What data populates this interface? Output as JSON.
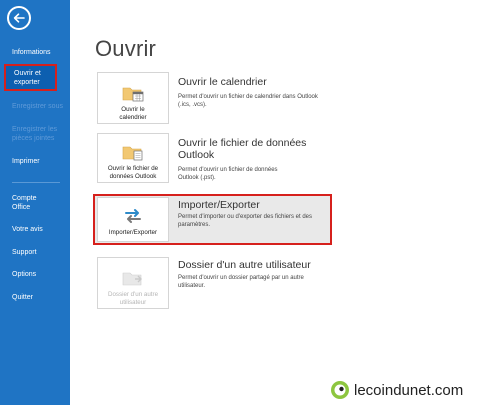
{
  "sidebar": {
    "items": [
      {
        "label": "Informations"
      },
      {
        "label": "Ouvrir et exporter"
      },
      {
        "label": "Enregistrer sous"
      },
      {
        "label": "Enregistrer les pièces jointes"
      },
      {
        "label": "Imprimer"
      },
      {
        "label": "Compte Office"
      },
      {
        "label": "Votre avis"
      },
      {
        "label": "Support"
      },
      {
        "label": "Options"
      },
      {
        "label": "Quitter"
      }
    ]
  },
  "main": {
    "title": "Ouvrir",
    "options": [
      {
        "tile_label": "Ouvrir le calendrier",
        "title": "Ouvrir le calendrier",
        "desc": "Permet d'ouvrir un fichier de calendrier dans Outlook (.ics, .vcs)."
      },
      {
        "tile_label": "Ouvrir le fichier de données Outlook",
        "title": "Ouvrir le fichier de données Outlook",
        "desc": "Permet d'ouvrir un fichier de données Outlook (.pst)."
      },
      {
        "tile_label": "Importer/Exporter",
        "title": "Importer/Exporter",
        "desc": "Permet d'importer ou d'exporter des fichiers et des paramètres."
      },
      {
        "tile_label": "Dossier d'un autre utilisateur",
        "title": "Dossier d'un autre utilisateur",
        "desc": "Permet d'ouvrir un dossier partagé par un autre utilisateur."
      }
    ]
  },
  "watermark": {
    "text": "lecoindunet.com"
  },
  "colors": {
    "sidebar": "#1f74c4",
    "highlight": "#d6201c",
    "accent_green": "#8dc63f"
  }
}
